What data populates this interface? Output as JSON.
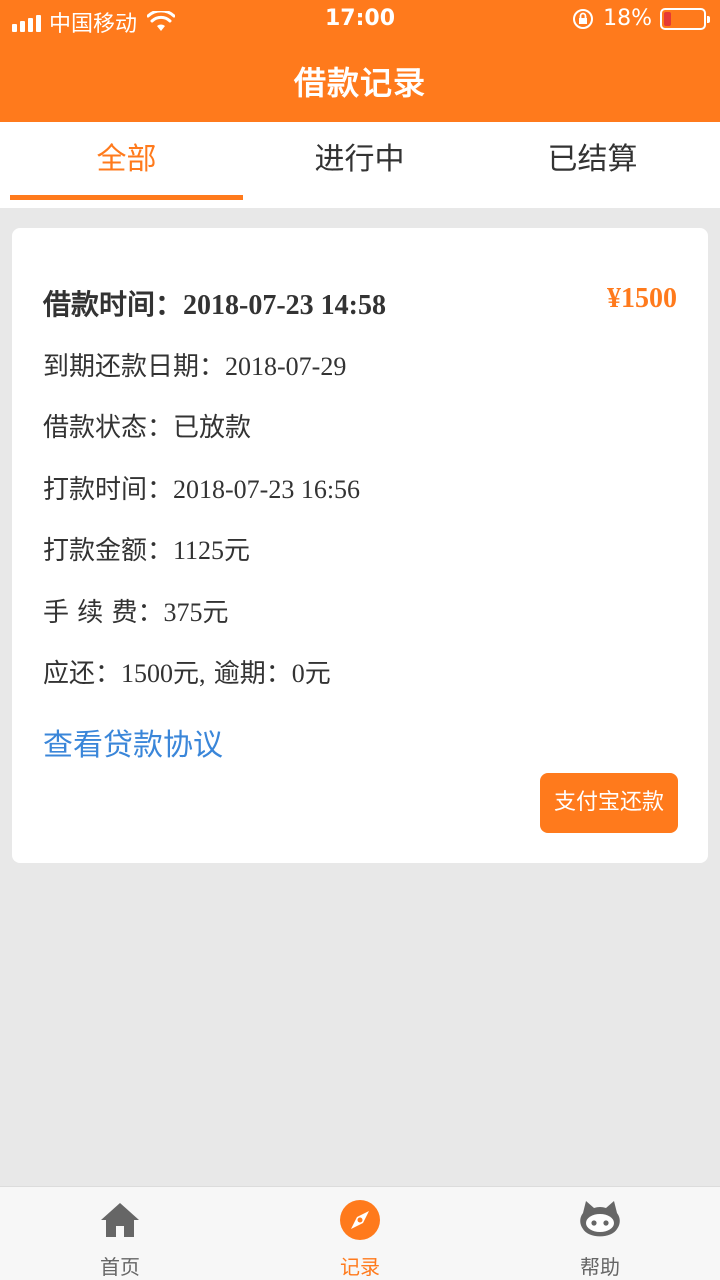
{
  "status_bar": {
    "carrier": "中国移动",
    "time": "17:00",
    "battery": "18%",
    "battery_level": 0.18,
    "icons": [
      "signal-icon",
      "wifi-icon",
      "orientation-lock-icon",
      "battery-icon"
    ]
  },
  "header": {
    "title": "借款记录"
  },
  "tabs": [
    {
      "label": "全部",
      "active": true
    },
    {
      "label": "进行中",
      "active": false
    },
    {
      "label": "已结算",
      "active": false
    }
  ],
  "record": {
    "loan_time_label": "借款时间：",
    "loan_time": "2018-07-23 14:58",
    "amount": "¥1500",
    "due_date_label": "到期还款日期：",
    "due_date": "2018-07-29",
    "status_label": "借款状态：",
    "status": "已放款",
    "payout_time_label": "打款时间：",
    "payout_time": "2018-07-23 16:56",
    "payout_amount_label": "打款金额：",
    "payout_amount": "1125元",
    "fee_label": "手 续 费：",
    "fee": "375元",
    "due_label": "应还：",
    "due_amount": "1500元,",
    "overdue_label": " 逾期：",
    "overdue_amount": "0元",
    "agreement_link": "查看贷款协议",
    "pay_button": "支付宝还款"
  },
  "bottom_nav": [
    {
      "label": "首页",
      "icon": "home-icon",
      "active": false
    },
    {
      "label": "记录",
      "icon": "compass-icon",
      "active": true
    },
    {
      "label": "帮助",
      "icon": "cat-icon",
      "active": false
    }
  ],
  "colors": {
    "accent": "#ff7a1c",
    "link": "#3a86d9",
    "background": "#e8e8e8",
    "battery_low": "#e53935"
  }
}
